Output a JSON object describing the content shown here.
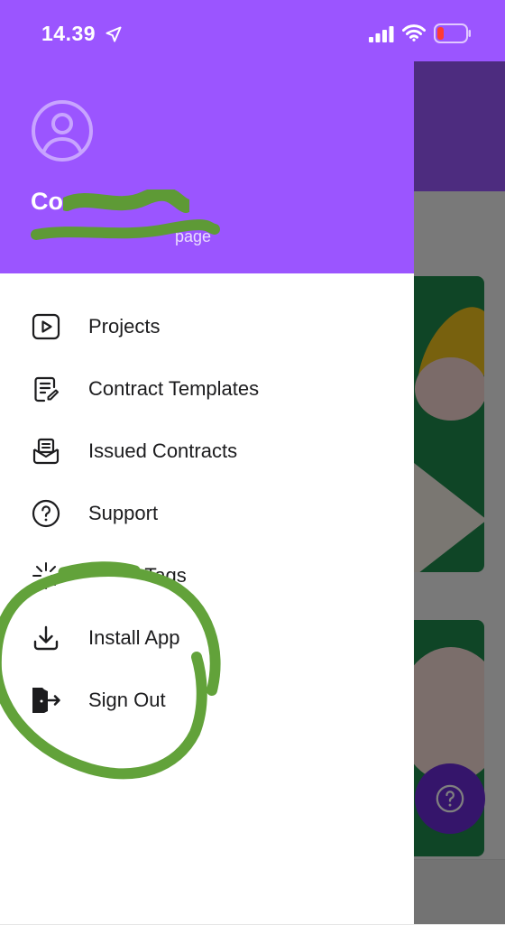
{
  "status_bar": {
    "time": "14.39",
    "icons": [
      "location-arrow-icon",
      "cellular-signal-icon",
      "wifi-icon",
      "battery-low-icon"
    ]
  },
  "colors": {
    "drawer_header": "#9b55ff",
    "text": "#1c1c1e",
    "annotation": "#62a23a",
    "battery_low": "#ff3b30"
  },
  "profile": {
    "name": "Co",
    "email": "page"
  },
  "menu": [
    {
      "label": "Projects",
      "icon": "play-square-icon"
    },
    {
      "label": "Contract Templates",
      "icon": "document-edit-icon"
    },
    {
      "label": "Issued Contracts",
      "icon": "mail-inbox-icon"
    },
    {
      "label": "Support",
      "icon": "help-circle-icon"
    },
    {
      "label": "-Tags",
      "icon": "sparkle-icon"
    },
    {
      "label": "Install App",
      "icon": "download-icon"
    },
    {
      "label": "Sign Out",
      "icon": "exit-door-icon"
    }
  ],
  "background": {
    "help_button_icon": "help-circle-icon"
  }
}
